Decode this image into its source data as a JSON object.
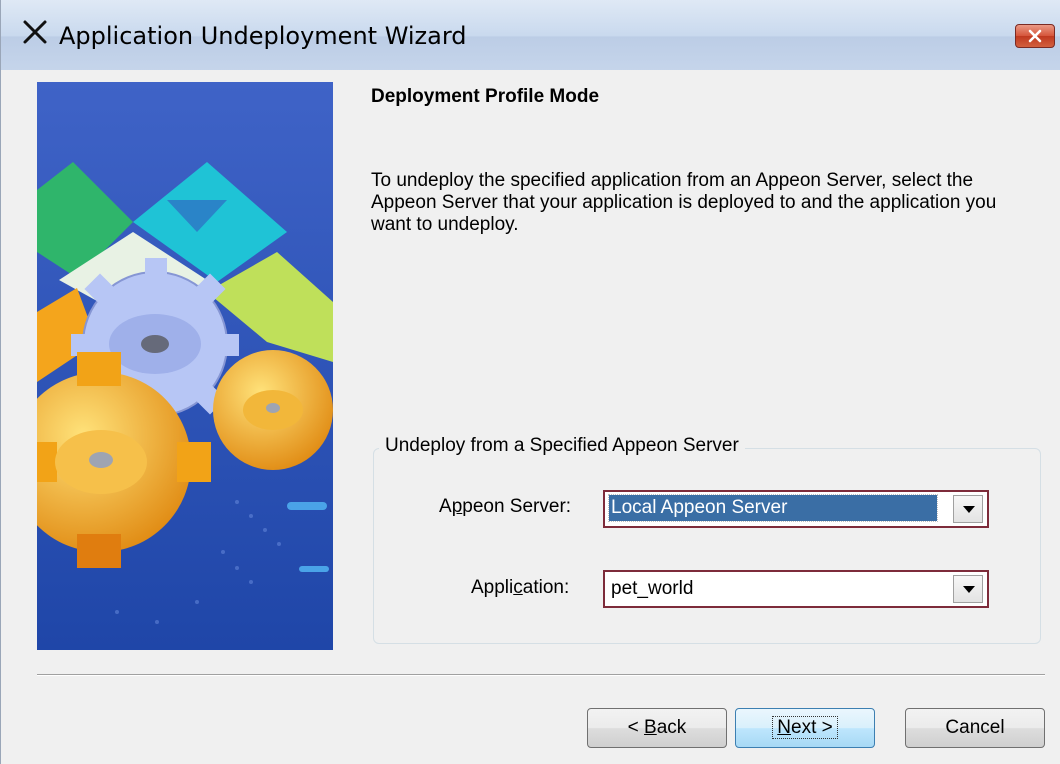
{
  "window": {
    "title": "Application Undeployment Wizard"
  },
  "page": {
    "heading": "Deployment Profile Mode",
    "description": "To undeploy the specified application from an Appeon Server, select the Appeon Server that your application is deployed to and the application you want to undeploy."
  },
  "group": {
    "title": "Undeploy from a Specified Appeon Server",
    "server": {
      "label_pre": "A",
      "label_ul": "p",
      "label_post": "peon Server:",
      "value": "Local Appeon Server"
    },
    "application": {
      "label_pre": "Appli",
      "label_ul": "c",
      "label_post": "ation:",
      "value": "pet_world"
    }
  },
  "buttons": {
    "back": {
      "prefix": "< ",
      "ul": "B",
      "rest": "ack"
    },
    "next": {
      "ul": "N",
      "rest": "ext >"
    },
    "cancel": {
      "label": "Cancel"
    }
  },
  "colors": {
    "banner": "#2a56b8",
    "selection": "#3a6ea5",
    "combo_border": "#7d2b3a"
  },
  "icons": {
    "app": "wizard-x-icon",
    "close": "close-icon",
    "dropdown": "chevron-down-icon"
  }
}
